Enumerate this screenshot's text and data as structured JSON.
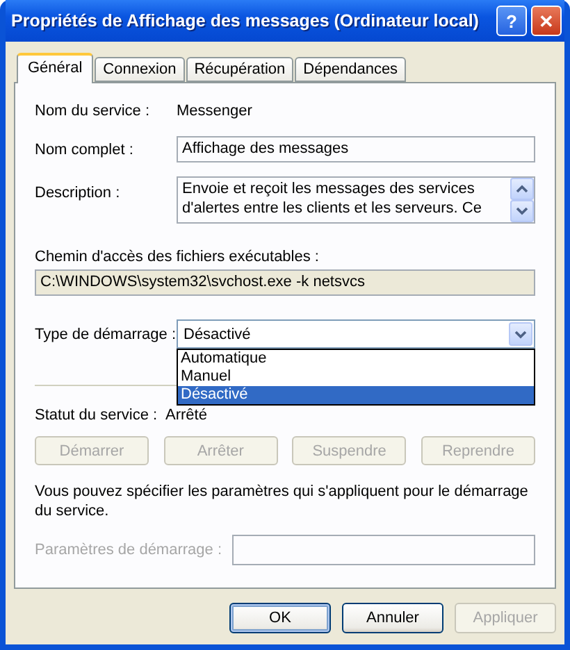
{
  "window": {
    "title": "Propriétés de Affichage des messages (Ordinateur local)",
    "buttons": [
      {
        "kind": "help",
        "label": "?"
      },
      {
        "kind": "close",
        "label": "✕"
      }
    ]
  },
  "tabs": [
    {
      "label": "Général",
      "selected": true
    },
    {
      "label": "Connexion",
      "selected": false
    },
    {
      "label": "Récupération",
      "selected": false
    },
    {
      "label": "Dépendances",
      "selected": false
    }
  ],
  "service_name": {
    "label": "Nom du service :",
    "value": "Messenger"
  },
  "display_name": {
    "label": "Nom complet :",
    "value": "Affichage des messages"
  },
  "description": {
    "label": "Description :",
    "value": "Envoie et reçoit les messages des services d'alertes entre les clients et les serveurs. Ce"
  },
  "path": {
    "label": "Chemin d'accès des fichiers exécutables :",
    "value": "C:\\WINDOWS\\system32\\svchost.exe -k netsvcs"
  },
  "startup_type": {
    "label": "Type de démarrage :",
    "value": "Désactivé",
    "expanded": true,
    "options": [
      {
        "label": "Automatique",
        "selected": false
      },
      {
        "label": "Manuel",
        "selected": false
      },
      {
        "label": "Désactivé",
        "selected": true
      }
    ]
  },
  "status": {
    "label": "Statut du service :",
    "value": "Arrêté"
  },
  "service_buttons": [
    {
      "label": "Démarrer",
      "disabled": true
    },
    {
      "label": "Arrêter",
      "disabled": true
    },
    {
      "label": "Suspendre",
      "disabled": true
    },
    {
      "label": "Reprendre",
      "disabled": true
    }
  ],
  "note": "Vous pouvez spécifier les paramètres qui s'appliquent pour le démarrage du service.",
  "start_params": {
    "label": "Paramètres de démarrage :",
    "disabled": true
  },
  "dialog_buttons": [
    {
      "label": "OK",
      "disabled": false,
      "default": true
    },
    {
      "label": "Annuler",
      "disabled": false,
      "default": false
    },
    {
      "label": "Appliquer",
      "disabled": true,
      "default": false
    }
  ]
}
